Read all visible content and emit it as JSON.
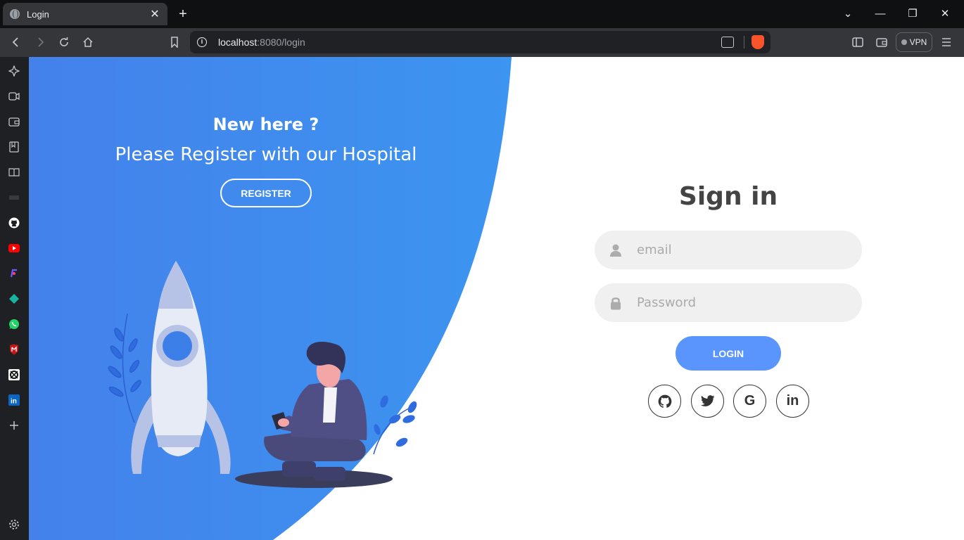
{
  "browser": {
    "tab_title": "Login",
    "tab_close": "✕",
    "new_tab": "+",
    "url_host": "localhost",
    "url_rest": ":8080/login",
    "vpn_label": "VPN",
    "window_controls": [
      "⌄",
      "—",
      "❐",
      "✕"
    ]
  },
  "left_panel": {
    "heading": "New here ?",
    "text": "Please Register with our Hospital",
    "register_label": "REGISTER",
    "color": "#3a8ef0"
  },
  "sign_in": {
    "title": "Sign in",
    "email_placeholder": "email",
    "password_placeholder": "Password",
    "login_label": "LOGIN",
    "social": [
      {
        "name": "github",
        "icon": "github-icon"
      },
      {
        "name": "twitter",
        "icon": "twitter-icon"
      },
      {
        "name": "google",
        "icon": "google-icon",
        "glyph": "G"
      },
      {
        "name": "linkedin",
        "icon": "linkedin-icon",
        "glyph": "in"
      }
    ]
  },
  "colors": {
    "accent": "#5995fd",
    "panel_blue": "#3a8ef0"
  }
}
